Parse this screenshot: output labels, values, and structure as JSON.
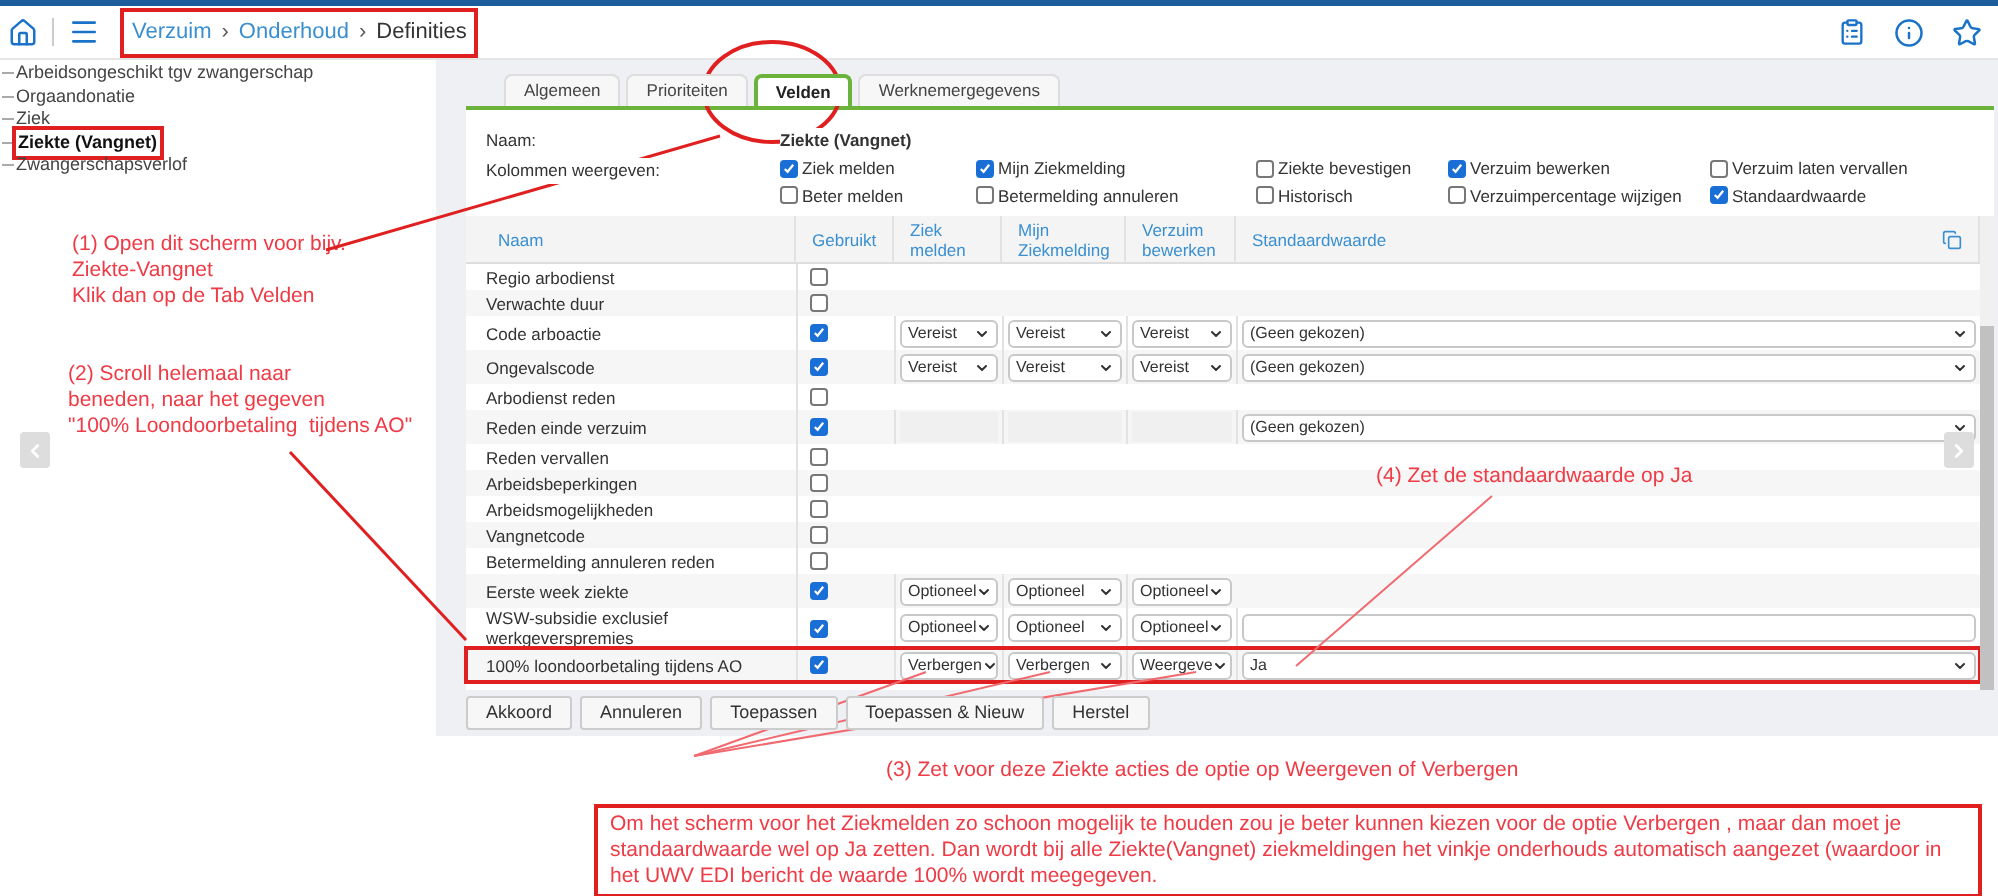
{
  "breadcrumb": {
    "separator": "›",
    "items": [
      {
        "label": "Verzuim",
        "link": true
      },
      {
        "label": "Onderhoud",
        "link": true
      },
      {
        "label": "Definities",
        "link": false
      }
    ]
  },
  "sidebar": {
    "items": [
      {
        "label": "Arbeidsongeschikt tgv zwangerschap",
        "selected": false
      },
      {
        "label": "Orgaandonatie",
        "selected": false
      },
      {
        "label": "Ziek",
        "selected": false
      },
      {
        "label": "Ziekte (Vangnet)",
        "selected": true
      },
      {
        "label": "Zwangerschapsverlof",
        "selected": false
      }
    ]
  },
  "tabs": [
    {
      "label": "Algemeen",
      "selected": false
    },
    {
      "label": "Prioriteiten",
      "selected": false
    },
    {
      "label": "Velden",
      "selected": true
    },
    {
      "label": "Werknemergegevens",
      "selected": false
    }
  ],
  "form": {
    "name_label": "Naam:",
    "name_value": "Ziekte (Vangnet)",
    "columns_label": "Kolommen weergeven:",
    "column_options": [
      {
        "label": "Ziek melden",
        "checked": true
      },
      {
        "label": "Mijn Ziekmelding",
        "checked": true
      },
      {
        "label": "Ziekte bevestigen",
        "checked": false
      },
      {
        "label": "Verzuim bewerken",
        "checked": true
      },
      {
        "label": "Verzuim laten vervallen",
        "checked": false
      },
      {
        "label": "Beter melden",
        "checked": false
      },
      {
        "label": "Betermelding annuleren",
        "checked": false
      },
      {
        "label": "Historisch",
        "checked": false
      },
      {
        "label": "Verzuimpercentage wijzigen",
        "checked": false
      },
      {
        "label": "Standaardwaarde",
        "checked": true
      }
    ]
  },
  "table": {
    "columns": [
      "Naam",
      "Gebruikt",
      "Ziek melden",
      "Mijn Ziekmelding",
      "Verzuim bewerken",
      "Standaardwaarde"
    ],
    "rows": [
      {
        "name": "Regio arbodienst",
        "used": false
      },
      {
        "name": "Verwachte duur",
        "used": false
      },
      {
        "name": "Code arboactie",
        "used": true,
        "cells": [
          {
            "kind": "select",
            "value": "Vereist"
          },
          {
            "kind": "select",
            "value": "Vereist"
          },
          {
            "kind": "select",
            "value": "Vereist"
          }
        ],
        "default": {
          "kind": "select",
          "value": "(Geen gekozen)"
        }
      },
      {
        "name": "Ongevalscode",
        "used": true,
        "cells": [
          {
            "kind": "select",
            "value": "Vereist"
          },
          {
            "kind": "select",
            "value": "Vereist"
          },
          {
            "kind": "select",
            "value": "Vereist"
          }
        ],
        "default": {
          "kind": "select",
          "value": "(Geen gekozen)"
        }
      },
      {
        "name": "Arbodienst reden",
        "used": false
      },
      {
        "name": "Reden einde verzuim",
        "used": true,
        "cells": [
          {
            "kind": "empty"
          },
          {
            "kind": "empty"
          },
          {
            "kind": "empty"
          }
        ],
        "default": {
          "kind": "select",
          "value": "(Geen gekozen)"
        }
      },
      {
        "name": "Reden vervallen",
        "used": false
      },
      {
        "name": "Arbeidsbeperkingen",
        "used": false
      },
      {
        "name": "Arbeidsmogelijkheden",
        "used": false
      },
      {
        "name": "Vangnetcode",
        "used": false
      },
      {
        "name": "Betermelding annuleren reden",
        "used": false
      },
      {
        "name": "Eerste week ziekte",
        "used": true,
        "cells": [
          {
            "kind": "select",
            "value": "Optioneel"
          },
          {
            "kind": "select",
            "value": "Optioneel"
          },
          {
            "kind": "select",
            "value": "Optioneel"
          }
        ]
      },
      {
        "name": "WSW-subsidie exclusief werkgeverspremies",
        "used": true,
        "cells": [
          {
            "kind": "select",
            "value": "Optioneel"
          },
          {
            "kind": "select",
            "value": "Optioneel"
          },
          {
            "kind": "select",
            "value": "Optioneel"
          }
        ],
        "default": {
          "kind": "input"
        }
      },
      {
        "name": "100% loondoorbetaling tijdens AO",
        "used": true,
        "highlighted": true,
        "cells": [
          {
            "kind": "select",
            "value": "Verbergen"
          },
          {
            "kind": "select",
            "value": "Verbergen"
          },
          {
            "kind": "select",
            "value": "Weergeve"
          }
        ],
        "default": {
          "kind": "select",
          "value": "Ja"
        }
      }
    ]
  },
  "buttons": [
    "Akkoord",
    "Annuleren",
    "Toepassen",
    "Toepassen & Nieuw",
    "Herstel"
  ],
  "annotations": [
    {
      "lines": [
        "(1) Open dit scherm voor bijv.",
        "Ziekte-Vangnet",
        "Klik dan op de Tab Velden"
      ]
    },
    {
      "lines": [
        "(2) Scroll helemaal naar",
        "beneden, naar het gegeven",
        "\"100% Loondoorbetaling  tijdens AO\""
      ]
    },
    {
      "lines": [
        "(4) Zet de standaardwaarde op Ja"
      ]
    },
    {
      "lines": [
        "(3) Zet voor deze Ziekte acties de optie op Weergeven of Verbergen"
      ]
    }
  ],
  "note": "Om het scherm voor het Ziekmelden zo schoon mogelijk te houden zou je beter kunnen kiezen voor de optie Verbergen , maar dan moet je standaardwaarde wel op Ja zetten. Dan wordt bij alle Ziekte(Vangnet) ziekmeldingen het vinkje onderhouds automatisch aangezet (waardoor in het UWV EDI bericht de waarde 100% wordt meegegeven."
}
